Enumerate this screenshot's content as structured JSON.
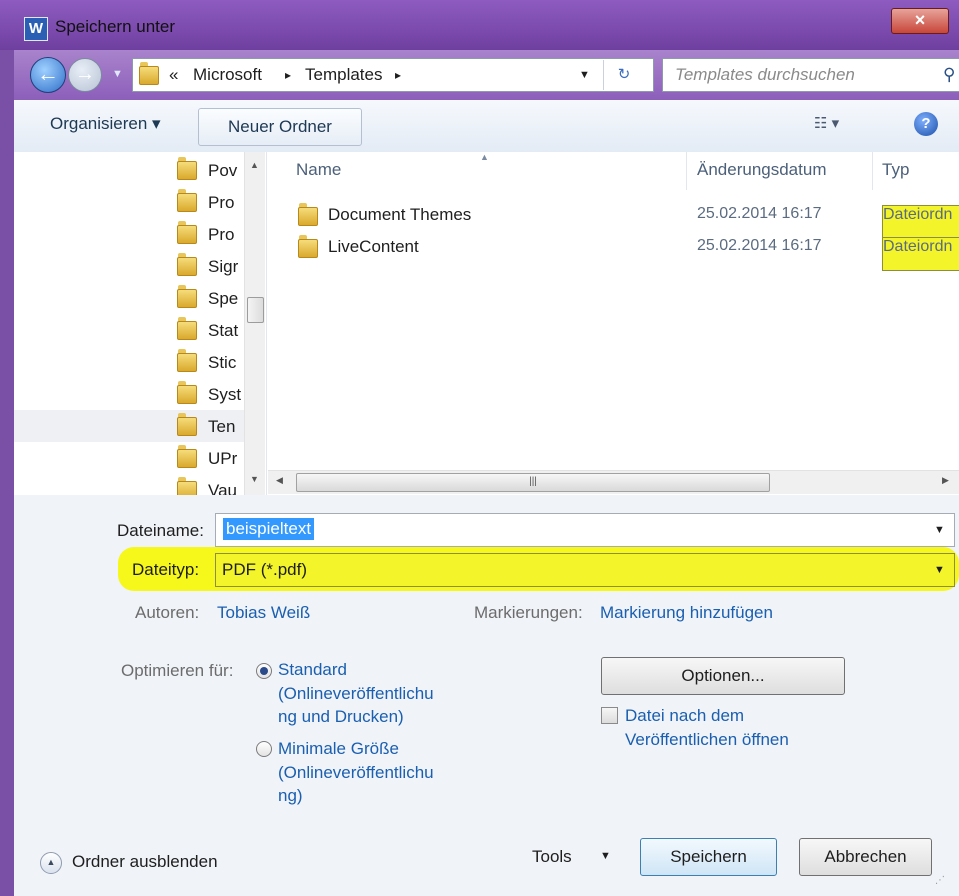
{
  "window": {
    "title": "Speichern unter",
    "app_icon": "W",
    "close": "×"
  },
  "nav": {
    "breadcrumbs": [
      "«",
      "Microsoft",
      "▸",
      "Templates",
      "▸"
    ],
    "search_placeholder": "Templates durchsuchen"
  },
  "toolbar": {
    "organize": "Organisieren ▾",
    "new_folder": "Neuer Ordner",
    "view": "☷ ▾",
    "help": "?"
  },
  "sidebar": {
    "items": [
      {
        "label": "Pov"
      },
      {
        "label": "Pro"
      },
      {
        "label": "Pro"
      },
      {
        "label": "Sigr"
      },
      {
        "label": "Spe"
      },
      {
        "label": "Stat"
      },
      {
        "label": "Stic"
      },
      {
        "label": "Syst"
      },
      {
        "label": "Ten"
      },
      {
        "label": "UPr"
      },
      {
        "label": "Vau"
      }
    ]
  },
  "files": {
    "columns": {
      "name": "Name",
      "date": "Änderungsdatum",
      "type": "Typ"
    },
    "rows": [
      {
        "name": "Document Themes",
        "date": "25.02.2014 16:17",
        "type": "Dateiordn"
      },
      {
        "name": "LiveContent",
        "date": "25.02.2014 16:17",
        "type": "Dateiordn"
      }
    ]
  },
  "form": {
    "filename_label": "Dateiname:",
    "filename_value": "beispieltext",
    "filetype_label": "Dateityp:",
    "filetype_value": "PDF (*.pdf)",
    "authors_label": "Autoren:",
    "authors_value": "Tobias Weiß",
    "tags_label": "Markierungen:",
    "tags_value": "Markierung hinzufügen",
    "optimize_label": "Optimieren für:",
    "opt_standard": [
      "Standard",
      "(Onlineveröffentlichu",
      "ng und Drucken)"
    ],
    "opt_minimal": [
      "Minimale Größe",
      "(Onlineveröffentlichu",
      "ng)"
    ],
    "options_button": "Optionen...",
    "open_after": [
      "Datei nach dem",
      "Veröffentlichen öffnen"
    ]
  },
  "footer": {
    "hide_folders": "Ordner ausblenden",
    "tools": "Tools",
    "save": "Speichern",
    "cancel": "Abbrechen"
  },
  "colors": {
    "titlebar": "#7a4fa6",
    "highlight": "#f6f71a",
    "link": "#1a5fb0"
  }
}
